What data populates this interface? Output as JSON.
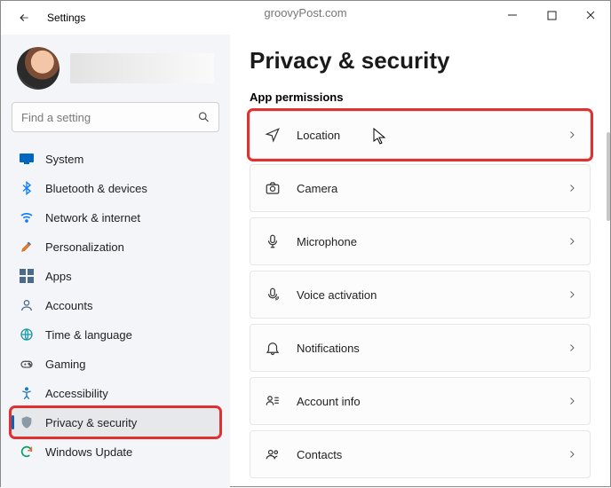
{
  "window": {
    "title": "Settings",
    "source_watermark": "groovyPost.com"
  },
  "search": {
    "placeholder": "Find a setting"
  },
  "sidebar": {
    "items": [
      {
        "label": "System"
      },
      {
        "label": "Bluetooth & devices"
      },
      {
        "label": "Network & internet"
      },
      {
        "label": "Personalization"
      },
      {
        "label": "Apps"
      },
      {
        "label": "Accounts"
      },
      {
        "label": "Time & language"
      },
      {
        "label": "Gaming"
      },
      {
        "label": "Accessibility"
      },
      {
        "label": "Privacy & security"
      },
      {
        "label": "Windows Update"
      }
    ],
    "active_index": 9
  },
  "page": {
    "title": "Privacy & security",
    "section": "App permissions"
  },
  "permissions": [
    {
      "label": "Location"
    },
    {
      "label": "Camera"
    },
    {
      "label": "Microphone"
    },
    {
      "label": "Voice activation"
    },
    {
      "label": "Notifications"
    },
    {
      "label": "Account info"
    },
    {
      "label": "Contacts"
    }
  ],
  "highlight": {
    "permission_index": 0,
    "sidebar_index": 9
  },
  "colors": {
    "accent": "#0067C0",
    "highlight_red": "#e03030",
    "sidebar_bg": "#F3F5F8"
  }
}
